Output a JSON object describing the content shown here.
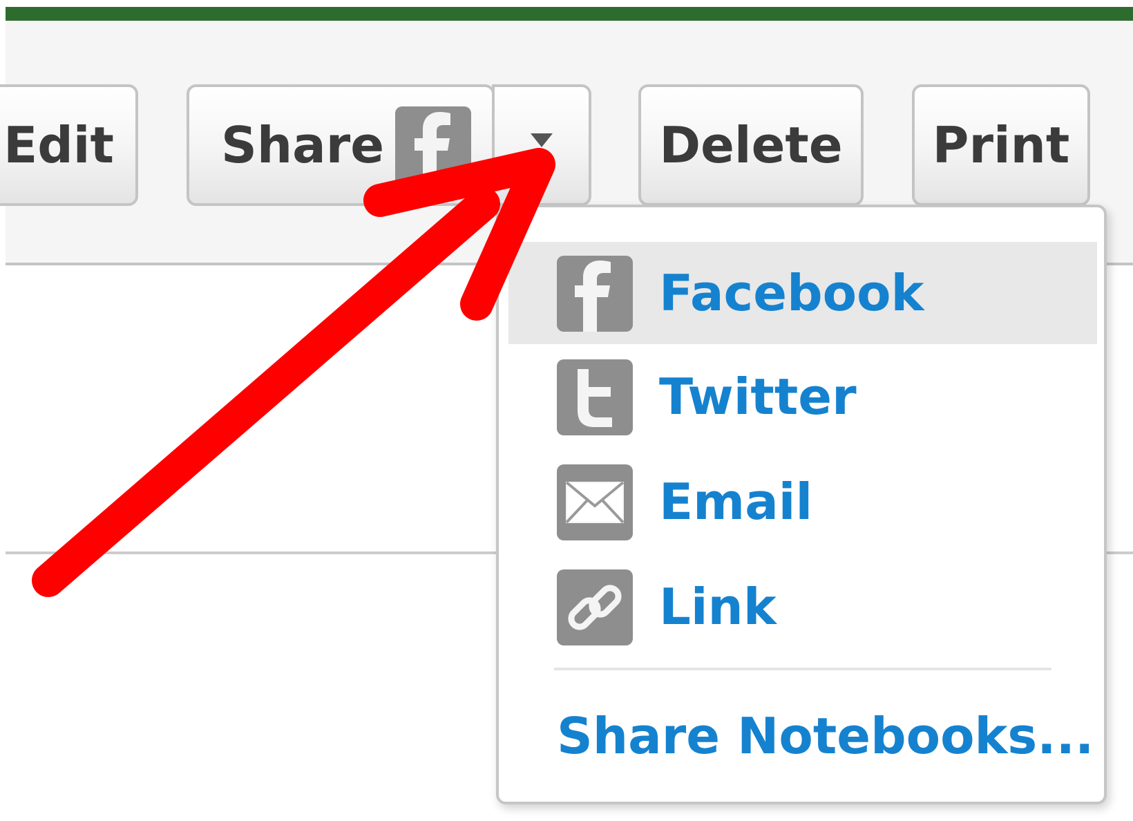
{
  "toolbar": {
    "edit_label": "Edit",
    "share_label": "Share",
    "delete_label": "Delete",
    "print_label": "Print"
  },
  "share_menu": {
    "items": [
      {
        "label": "Facebook",
        "icon": "facebook-icon"
      },
      {
        "label": "Twitter",
        "icon": "twitter-icon"
      },
      {
        "label": "Email",
        "icon": "email-icon"
      },
      {
        "label": "Link",
        "icon": "link-icon"
      }
    ],
    "footer_label": "Share Notebooks..."
  },
  "colors": {
    "top_bar": "#2e6b2e",
    "link_blue": "#1582cf",
    "icon_gray": "#8e8e8e",
    "annotation_red": "#ff0000"
  }
}
